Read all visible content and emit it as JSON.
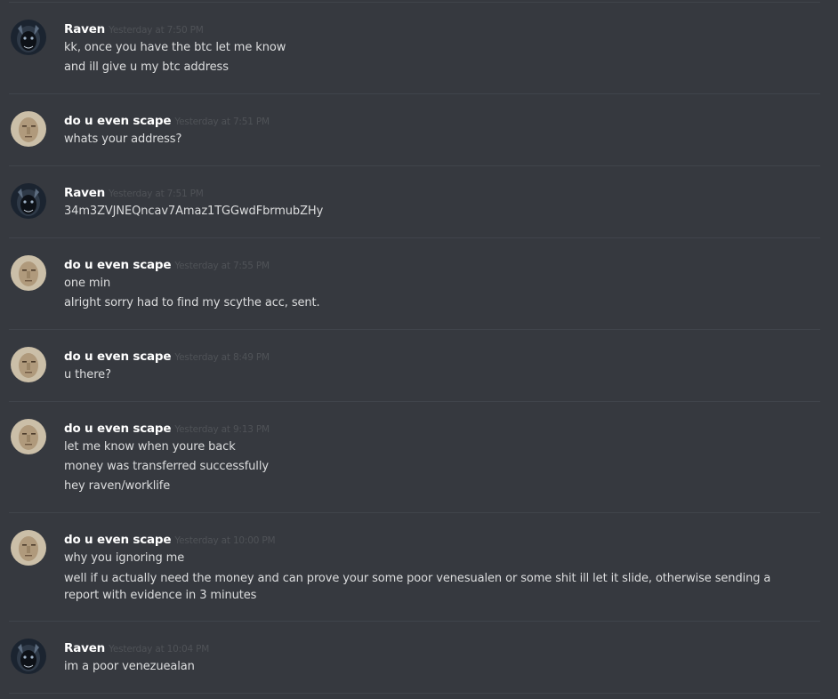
{
  "colors": {
    "background": "#36393f",
    "divider": "#40444b",
    "username": "#ffffff",
    "timestamp": "#4f5257",
    "text": "#dcddde"
  },
  "messages": [
    {
      "author": "Raven",
      "avatar": "raven-avatar-icon",
      "timestamp": "Yesterday at 7:50 PM",
      "lines": [
        "kk, once you have the btc let me know",
        "and ill give u my btc address"
      ]
    },
    {
      "author": "do u even scape",
      "avatar": "scape-avatar-icon",
      "timestamp": "Yesterday at 7:51 PM",
      "lines": [
        "whats your address?"
      ]
    },
    {
      "author": "Raven",
      "avatar": "raven-avatar-icon",
      "timestamp": "Yesterday at 7:51 PM",
      "lines": [
        "34m3ZVJNEQncav7Amaz1TGGwdFbrmubZHy"
      ]
    },
    {
      "author": "do u even scape",
      "avatar": "scape-avatar-icon",
      "timestamp": "Yesterday at 7:55 PM",
      "lines": [
        "one min",
        "alright sorry had to find my scythe acc, sent."
      ]
    },
    {
      "author": "do u even scape",
      "avatar": "scape-avatar-icon",
      "timestamp": "Yesterday at 8:49 PM",
      "lines": [
        "u there?"
      ]
    },
    {
      "author": "do u even scape",
      "avatar": "scape-avatar-icon",
      "timestamp": "Yesterday at 9:13 PM",
      "lines": [
        "let me know when youre back",
        "money was transferred successfully",
        "hey raven/worklife"
      ]
    },
    {
      "author": "do u even scape",
      "avatar": "scape-avatar-icon",
      "timestamp": "Yesterday at 10:00 PM",
      "lines": [
        "why you ignoring me",
        "well if u actually need the money and can prove your some poor venesualen or some shit ill let it slide, otherwise sending a report with evidence in 3 minutes"
      ]
    },
    {
      "author": "Raven",
      "avatar": "raven-avatar-icon",
      "timestamp": "Yesterday at 10:04 PM",
      "lines": [
        "im a poor venezuealan"
      ]
    }
  ]
}
